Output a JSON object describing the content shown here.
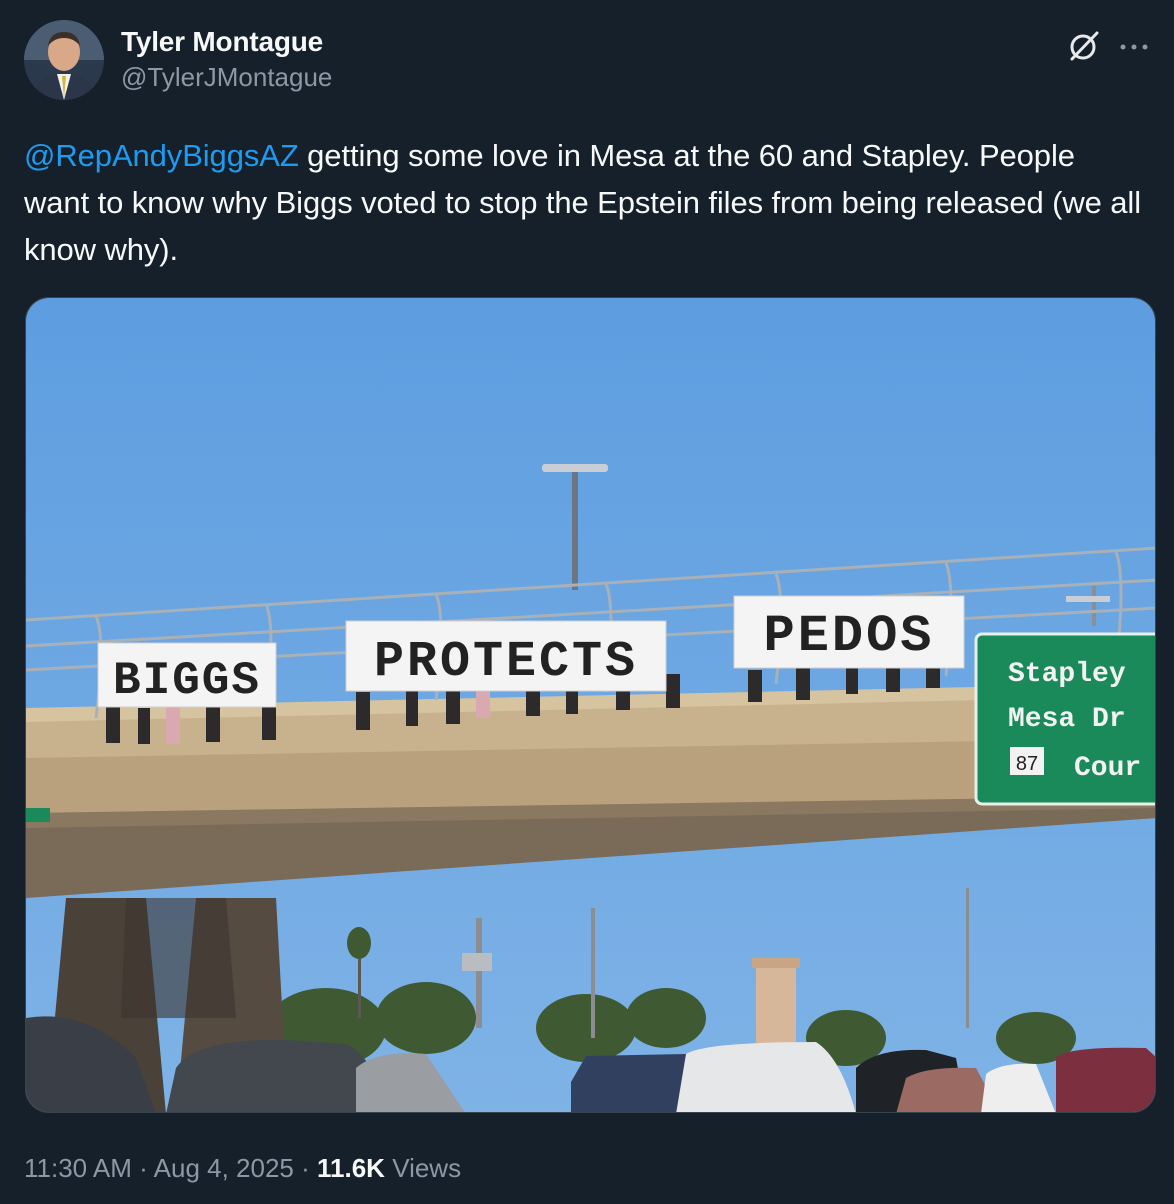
{
  "author": {
    "display_name": "Tyler Montague",
    "handle": "@TylerJMontague",
    "avatar_icon": "user-avatar"
  },
  "header_icons": [
    "grok-icon",
    "more-icon"
  ],
  "tweet": {
    "mention": "@RepAndyBiggsAZ",
    "text": " getting some love in Mesa at the 60 and Stapley. People want to know why Biggs voted to stop the Epstein files from being released (we all know why)."
  },
  "media": {
    "sign_words": [
      "BIGGS",
      "PROTECTS",
      "PEDOS"
    ],
    "highway_sign": {
      "line1": "Stapley",
      "line2": "Mesa Dr",
      "route_number": "87",
      "line3": "Cour"
    }
  },
  "meta": {
    "time": "11:30 AM",
    "separator": "·",
    "date": "Aug 4, 2025",
    "views_count": "11.6K",
    "views_label": "Views"
  },
  "colors": {
    "background": "#15202b",
    "link": "#1d9bf0",
    "secondary_text": "#8b98a5",
    "sky": "#5f9fdd",
    "sign_green": "#1b8a5a"
  }
}
